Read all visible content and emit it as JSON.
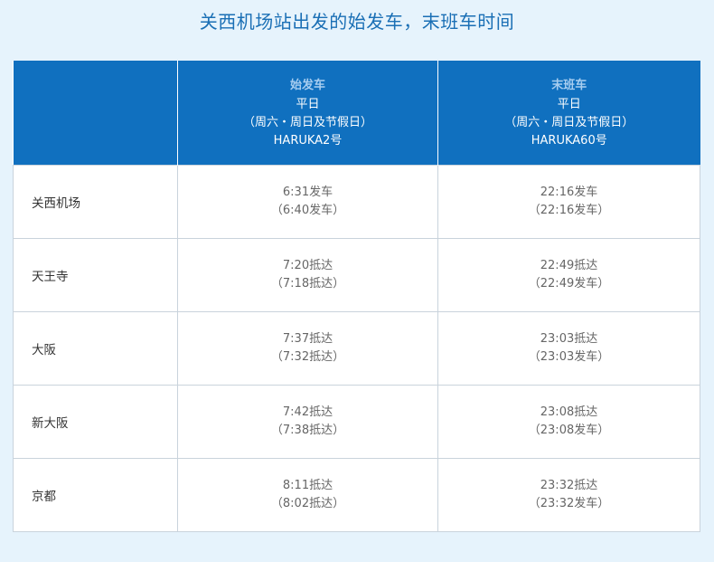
{
  "title": "关西机场站出发的始发车，末班车时间",
  "header": {
    "station_col": "",
    "first_train": {
      "label": "始发车",
      "line1": "平日",
      "line2": "（周六・周日及节假日）",
      "train": "HARUKA2号"
    },
    "last_train": {
      "label": "末班车",
      "line1": "平日",
      "line2": "（周六・周日及节假日）",
      "train": "HARUKA60号"
    }
  },
  "rows": [
    {
      "station": "关西机场",
      "first": [
        "6:31发车",
        "（6:40发车）"
      ],
      "last": [
        "22:16发车",
        "（22:16发车）"
      ]
    },
    {
      "station": "天王寺",
      "first": [
        "7:20抵达",
        "（7:18抵达）"
      ],
      "last": [
        "22:49抵达",
        "（22:49发车）"
      ]
    },
    {
      "station": "大阪",
      "first": [
        "7:37抵达",
        "（7:32抵达）"
      ],
      "last": [
        "23:03抵达",
        "（23:03发车）"
      ]
    },
    {
      "station": "新大阪",
      "first": [
        "7:42抵达",
        "（7:38抵达）"
      ],
      "last": [
        "23:08抵达",
        "（23:08发车）"
      ]
    },
    {
      "station": "京都",
      "first": [
        "8:11抵达",
        "（8:02抵达）"
      ],
      "last": [
        "23:32抵达",
        "（23:32发车）"
      ]
    }
  ]
}
